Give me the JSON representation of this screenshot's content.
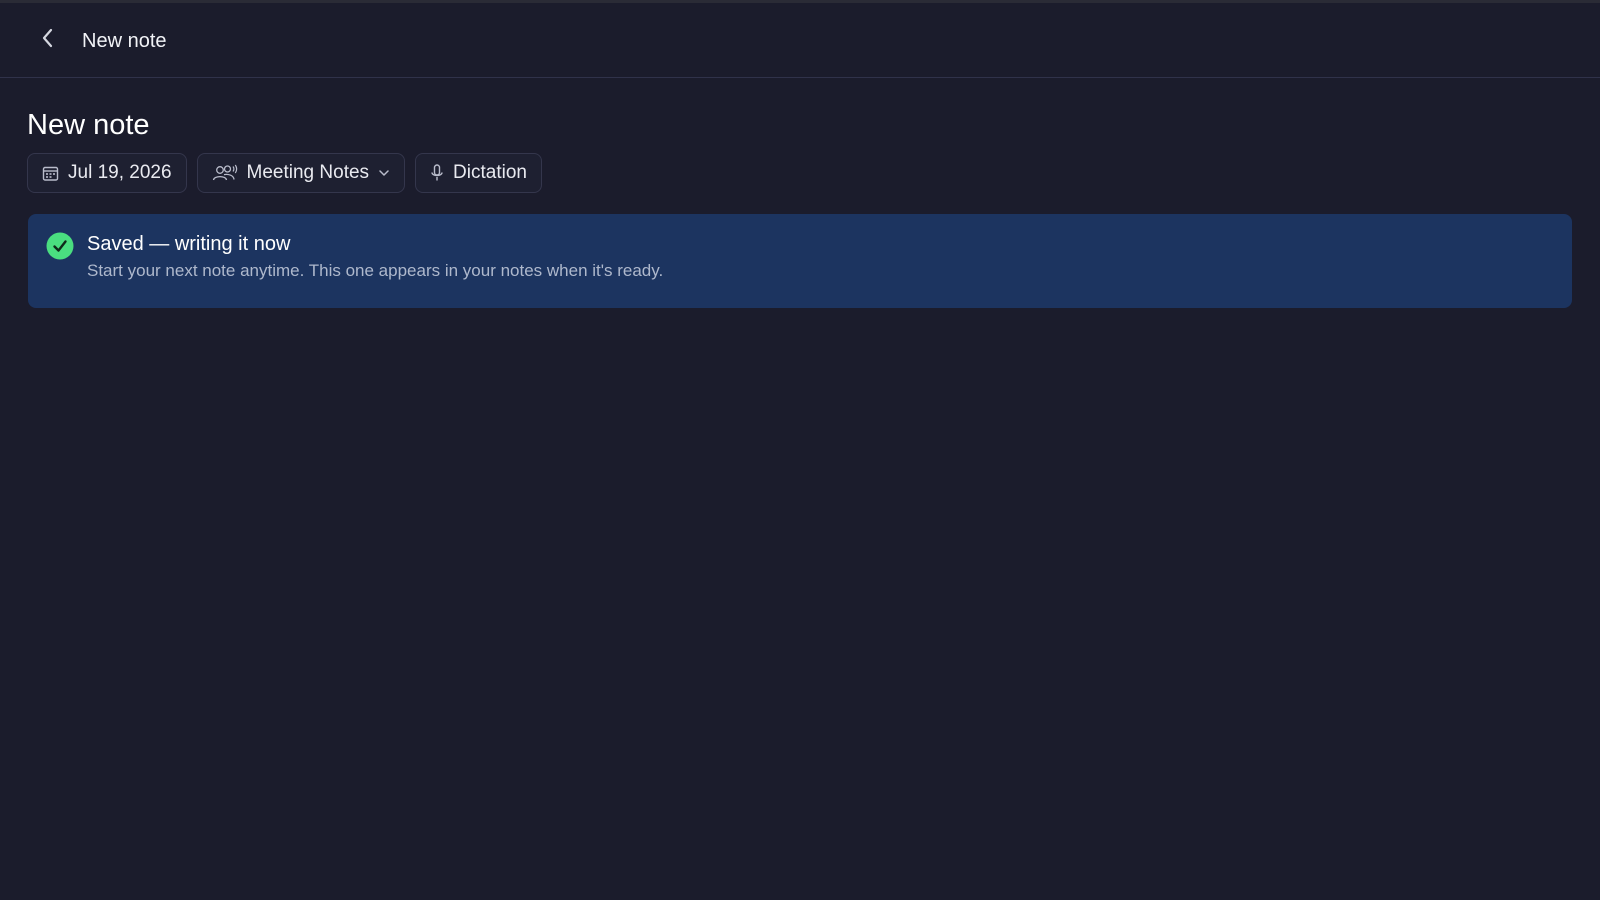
{
  "header": {
    "title": "New note",
    "back_icon": "chevron-left-icon"
  },
  "page": {
    "title": "New note"
  },
  "chips": {
    "date": {
      "label": "Jul 19, 2026",
      "icon": "calendar-icon"
    },
    "template": {
      "label": "Meeting Notes",
      "icon": "people-icon",
      "dropdown_icon": "chevron-down-icon"
    },
    "mode": {
      "label": "Dictation",
      "icon": "microphone-icon"
    }
  },
  "banner": {
    "title": "Saved — writing it now",
    "body": "Start your next note anytime. This one appears in your notes when it's ready.",
    "icon": "check-circle-icon",
    "background": "#1c3460",
    "icon_color": "#4ade80"
  },
  "colors": {
    "background": "#1b1c2c",
    "chip_border": "#34364c"
  }
}
